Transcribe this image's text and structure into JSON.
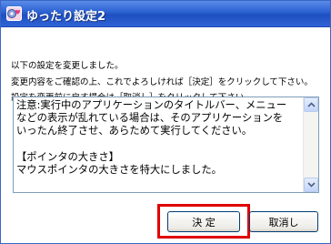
{
  "window": {
    "title": "ゆったり設定2",
    "icon": "gear-heart-icon"
  },
  "message": {
    "line1": "以下の設定を変更しました。",
    "line2": "変更内容をご確認の上、これでよろしければ［決定］をクリックして下さい。",
    "line3": "設定を変更前に戻す場合は［取消し］をクリックして下さい。"
  },
  "details": {
    "lines": [
      "注意:実行中のアプリケーションのタイトルバー、メニュー",
      "などの表示が乱れている場合は、そのアプリケーションを",
      "いったん終了させ、あらためて実行してください。",
      "",
      "【ポインタの大きさ】",
      "マウスポインタの大きさを特大にしました。"
    ]
  },
  "buttons": {
    "ok_label": "決 定",
    "cancel_label": "取消し"
  },
  "colors": {
    "titlebar": "#2a5fd0",
    "highlight": "#e00000"
  }
}
